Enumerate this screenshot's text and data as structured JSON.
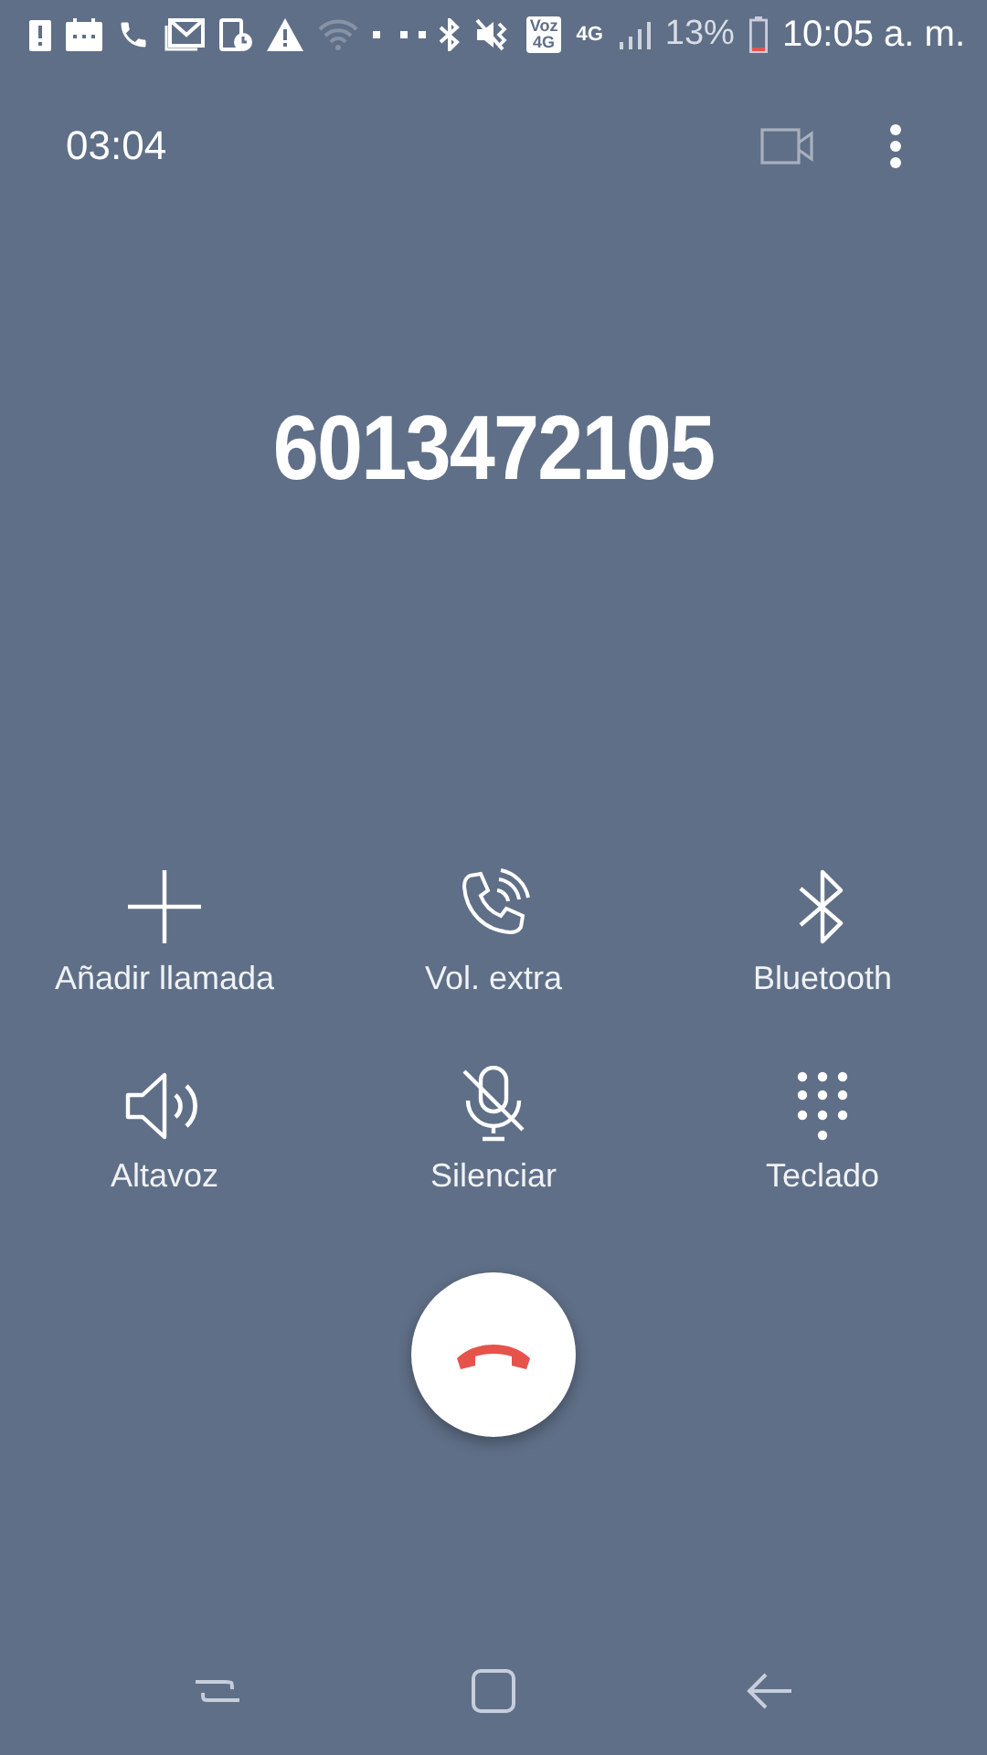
{
  "status_bar": {
    "volte_badge": [
      "Voz",
      "4G"
    ],
    "network": "4G",
    "battery": "13%",
    "time": "10:05 a. m."
  },
  "call": {
    "duration": "03:04",
    "video_call": {
      "disabled": true
    },
    "number": "6013472105"
  },
  "actions": [
    {
      "kind": "add",
      "label": "Añadir llamada"
    },
    {
      "kind": "volume",
      "label": "Vol. extra"
    },
    {
      "kind": "bluetooth",
      "label": "Bluetooth"
    },
    {
      "kind": "speaker",
      "label": "Altavoz"
    },
    {
      "kind": "mute",
      "label": "Silenciar"
    },
    {
      "kind": "keypad",
      "label": "Teclado"
    }
  ]
}
